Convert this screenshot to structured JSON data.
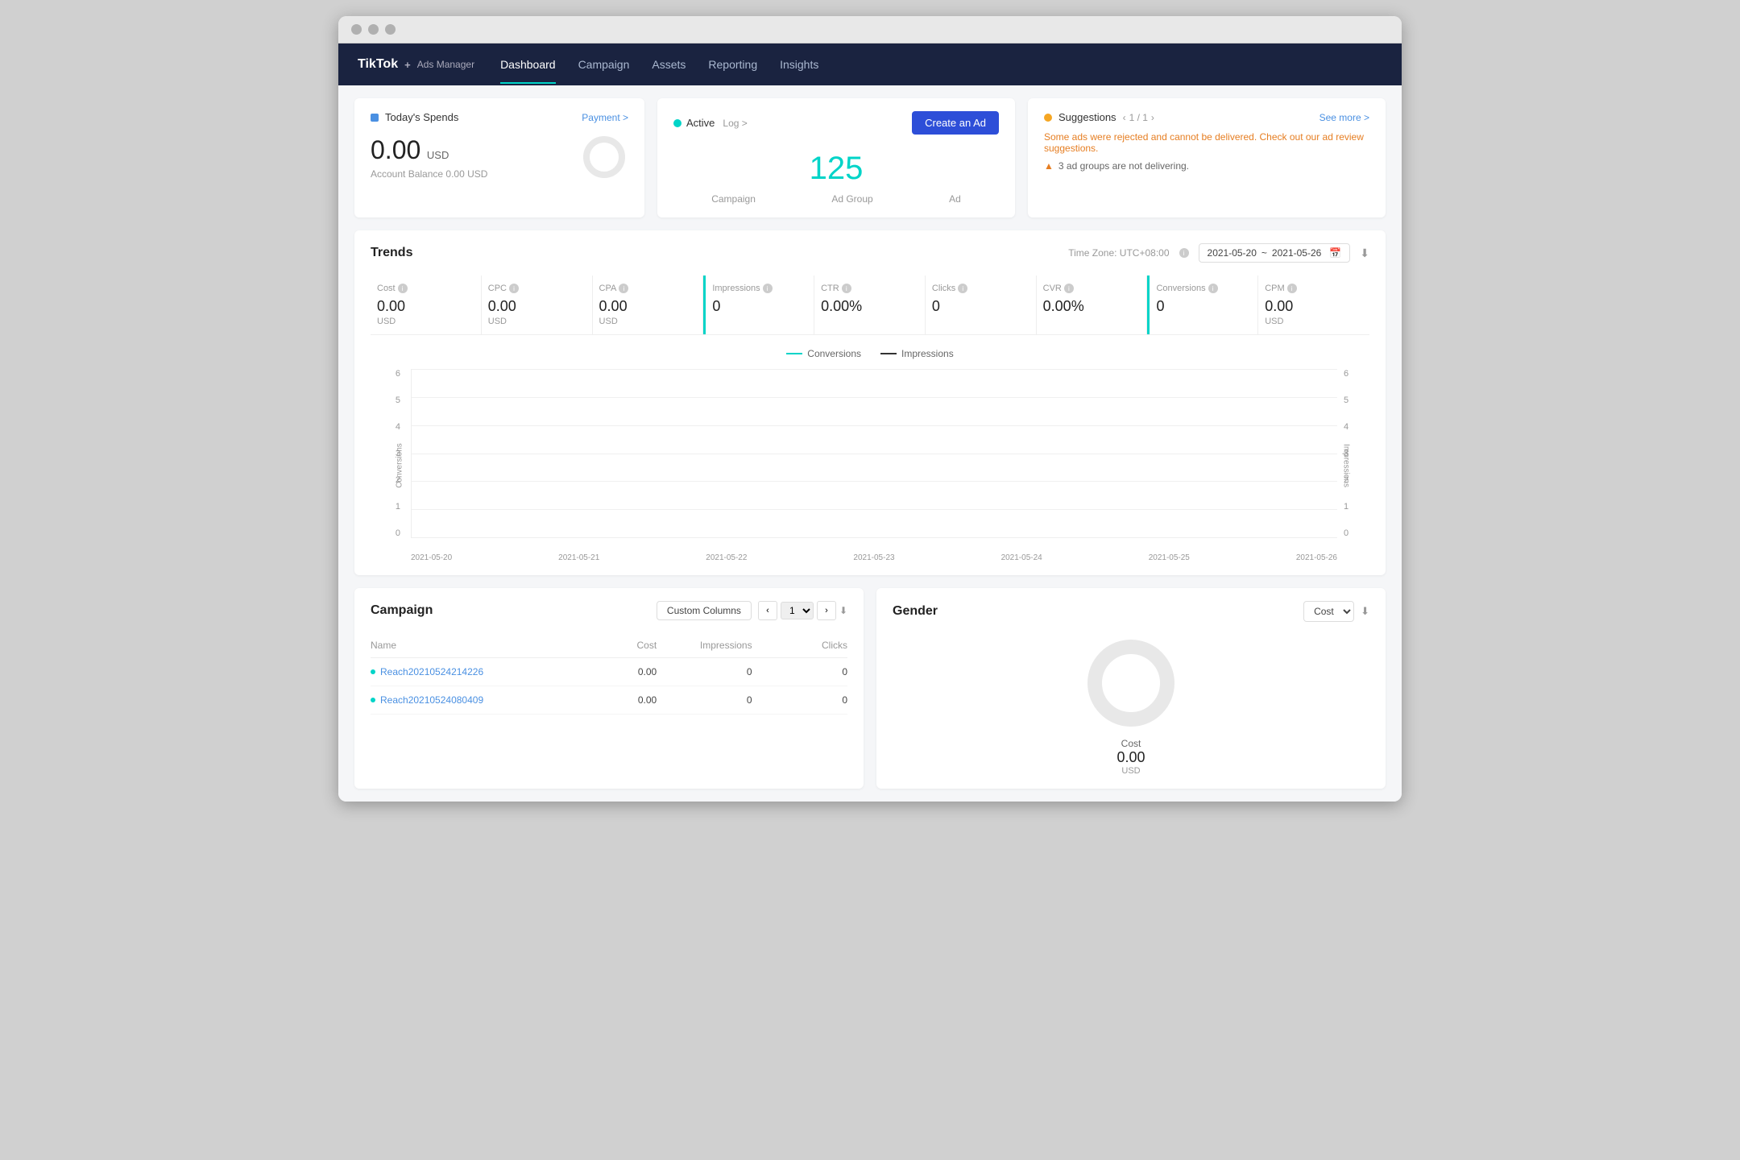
{
  "browser": {
    "dots": [
      "red",
      "yellow",
      "green"
    ]
  },
  "nav": {
    "logo": "TikTok",
    "logo_sub": "Ads Manager",
    "items": [
      {
        "label": "Dashboard",
        "active": true
      },
      {
        "label": "Campaign",
        "active": false
      },
      {
        "label": "Assets",
        "active": false
      },
      {
        "label": "Reporting",
        "active": false
      },
      {
        "label": "Insights",
        "active": false
      }
    ]
  },
  "spends": {
    "title": "Today's Spends",
    "payment_label": "Payment >",
    "amount": "0.00",
    "currency": "USD",
    "balance_label": "Account Balance 0.00 USD"
  },
  "active": {
    "status_label": "Active",
    "log_label": "Log >",
    "create_ad_label": "Create an Ad",
    "number": "125",
    "campaign_label": "Campaign",
    "ad_group_label": "Ad Group",
    "ad_label": "Ad"
  },
  "suggestions": {
    "title": "Suggestions",
    "pagination": "1 / 1",
    "see_more": "See more >",
    "rejected_text": "Some ads were rejected and cannot be delivered. Check out our ad review suggestions.",
    "warning_text": "3 ad groups are not delivering."
  },
  "trends": {
    "title": "Trends",
    "timezone_label": "Time Zone: UTC+08:00",
    "date_start": "2021-05-20",
    "date_end": "2021-05-26",
    "date_separator": "~",
    "metrics": [
      {
        "label": "Cost",
        "value": "0.00",
        "unit": "USD",
        "highlighted": false
      },
      {
        "label": "CPC",
        "value": "0.00",
        "unit": "USD",
        "highlighted": false
      },
      {
        "label": "CPA",
        "value": "0.00",
        "unit": "USD",
        "highlighted": false
      },
      {
        "label": "Impressions",
        "value": "0",
        "unit": "",
        "highlighted": true,
        "highlight_color": "teal"
      },
      {
        "label": "CTR",
        "value": "0.00%",
        "unit": "",
        "highlighted": false
      },
      {
        "label": "Clicks",
        "value": "0",
        "unit": "",
        "highlighted": false
      },
      {
        "label": "CVR",
        "value": "0.00%",
        "unit": "",
        "highlighted": false
      },
      {
        "label": "Conversions",
        "value": "0",
        "unit": "",
        "highlighted": true,
        "highlight_color": "teal"
      },
      {
        "label": "CPM",
        "value": "0.00",
        "unit": "USD",
        "highlighted": false
      }
    ],
    "chart_legend": [
      {
        "label": "Conversions",
        "color": "teal"
      },
      {
        "label": "Impressions",
        "color": "dark"
      }
    ],
    "y_axis_left": [
      "6",
      "5",
      "4",
      "3",
      "2",
      "1",
      "0"
    ],
    "y_axis_right": [
      "6",
      "5",
      "4",
      "3",
      "2",
      "1",
      "0"
    ],
    "x_axis": [
      "2021-05-20",
      "2021-05-21",
      "2021-05-22",
      "2021-05-23",
      "2021-05-24",
      "2021-05-25",
      "2021-05-26"
    ],
    "y_label_left": "Conversions",
    "y_label_right": "Impressions"
  },
  "campaign_table": {
    "title": "Campaign",
    "custom_columns_label": "Custom Columns",
    "page_number": "1",
    "columns": [
      "Name",
      "Cost",
      "Impressions",
      "Clicks"
    ],
    "rows": [
      {
        "name": "Reach20210524214226",
        "cost": "0.00",
        "impressions": "0",
        "clicks": "0"
      },
      {
        "name": "Reach20210524080409",
        "cost": "0.00",
        "impressions": "0",
        "clicks": "0"
      }
    ]
  },
  "gender_card": {
    "title": "Gender",
    "cost_label": "Cost",
    "cost_value": "0.00",
    "cost_unit": "USD"
  },
  "icons": {
    "info": "ⓘ",
    "calendar": "📅",
    "download": "⬇",
    "chevron_left": "‹",
    "chevron_right": "›",
    "chevron_down": "∨",
    "warning_triangle": "▲"
  }
}
